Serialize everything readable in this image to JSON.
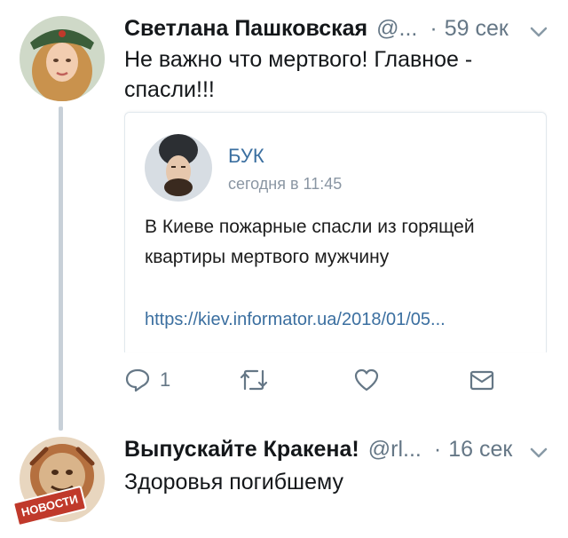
{
  "tweet1": {
    "author": "Светлана Пашковская",
    "handle": "@...",
    "separator": "·",
    "time": "59 сек",
    "text_line1": "Не важно что мертвого! Главное -",
    "text_line2": "спасли!!!",
    "quoted": {
      "source": "БУК",
      "timestamp": "сегодня в 11:45",
      "text_line1": "В Киеве пожарные спасли из горящей",
      "text_line2": "квартиры мертвого мужчину",
      "link": "https://kiev.informator.ua/2018/01/05..."
    },
    "actions": {
      "reply_count": "1",
      "reply_icon": "reply-icon",
      "retweet_icon": "retweet-icon",
      "like_icon": "heart-icon",
      "dm_icon": "envelope-icon"
    }
  },
  "tweet2": {
    "author": "Выпускайте Кракена!",
    "handle": "@rl...",
    "separator": "·",
    "time": "16 сек",
    "text": "Здоровья погибшему",
    "avatar_badge": "НОВОСТИ"
  },
  "colors": {
    "text": "#14171a",
    "muted": "#657786",
    "link": "#3b6fa0",
    "thread_line": "#c8d0d8"
  }
}
